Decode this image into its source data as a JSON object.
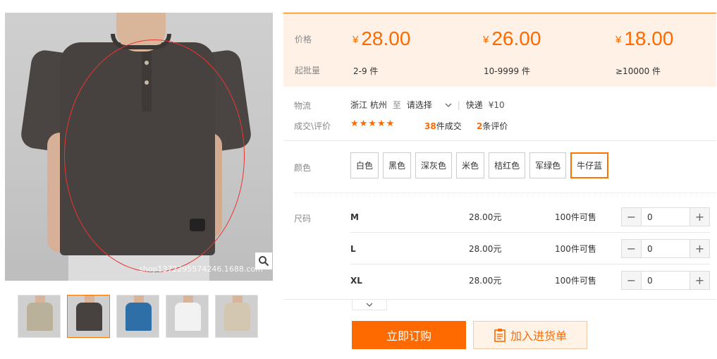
{
  "gallery": {
    "watermark": "shop1372295574246.1688.com",
    "thumbnails": [
      {
        "name": "thumb-green-beige",
        "color": "#bdb19a"
      },
      {
        "name": "thumb-dark-grey",
        "color": "#47423f"
      },
      {
        "name": "thumb-blue",
        "color": "#2f6fa8"
      },
      {
        "name": "thumb-white",
        "color": "#f2f2f2"
      },
      {
        "name": "thumb-beige",
        "color": "#d4c7b2"
      }
    ]
  },
  "pricing": {
    "price_label": "价格",
    "moq_label": "起批量",
    "currency": "¥",
    "tiers": [
      {
        "price": "28.00",
        "range": "2-9 件"
      },
      {
        "price": "26.00",
        "range": "10-9999 件"
      },
      {
        "price": "18.00",
        "range": "≥10000 件"
      }
    ]
  },
  "logistics": {
    "label": "物流",
    "from": "浙江 杭州",
    "to_word": "至",
    "dest": "请选择",
    "express": "快递",
    "fee": "¥10"
  },
  "sales": {
    "label": "成交\\评价",
    "stars": "★★★★★",
    "deal_count": "38",
    "deal_suffix": "件成交",
    "review_count": "2",
    "review_suffix": "条评价"
  },
  "color": {
    "label": "颜色",
    "options": [
      "白色",
      "黑色",
      "深灰色",
      "米色",
      "桔红色",
      "军绿色",
      "牛仔蓝"
    ],
    "selected": "牛仔蓝"
  },
  "size": {
    "label": "尺码",
    "rows": [
      {
        "name": "M",
        "price": "28.00元",
        "stock": "100件可售",
        "qty": "0"
      },
      {
        "name": "L",
        "price": "28.00元",
        "stock": "100件可售",
        "qty": "0"
      },
      {
        "name": "XL",
        "price": "28.00元",
        "stock": "100件可售",
        "qty": "0"
      }
    ]
  },
  "actions": {
    "buy_now": "立即订购",
    "add_to_list": "加入进货单"
  },
  "theme": {
    "accent": "#ff6a00",
    "price_bg": "#fff1e6"
  }
}
